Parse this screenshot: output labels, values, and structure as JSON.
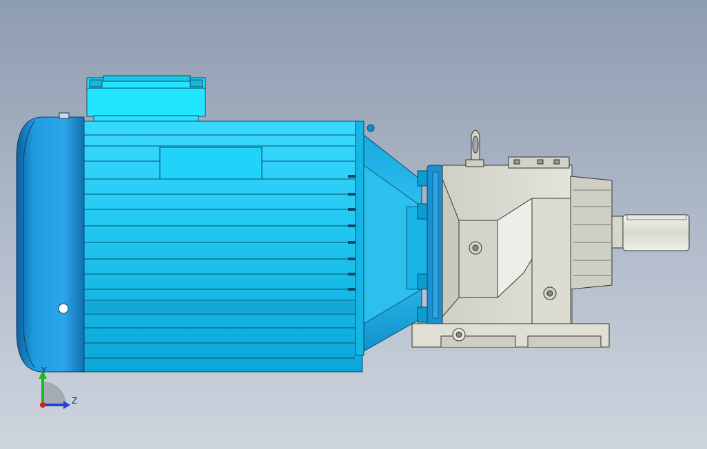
{
  "viewport": {
    "background_top": "#8e9cb0",
    "background_bottom": "#cfd5de"
  },
  "model": {
    "motor_color": "#1ec8f2",
    "motor_dark": "#0a6f9a",
    "endcap_color": "#1a90d6",
    "gearbox_color": "#d9d9d2",
    "shaft_color": "#e6e6e0"
  },
  "triad": {
    "y_label": "Y",
    "z_label": "Z",
    "y_color": "#1fb81f",
    "z_color": "#2a3fd6",
    "x_color": "#d41f1f"
  }
}
